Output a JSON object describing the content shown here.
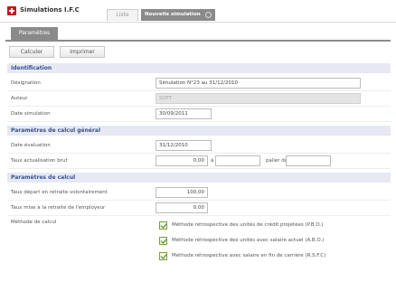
{
  "app": {
    "title": "Simulations I.F.C",
    "tabs": [
      {
        "label": "Liste"
      },
      {
        "label": "Nouvelle simulation"
      }
    ]
  },
  "subtabs": [
    {
      "label": "Paramètres"
    }
  ],
  "toolbar": {
    "calculate_label": "Calculer",
    "print_label": "Imprimer"
  },
  "identification": {
    "title": "Identification",
    "designation_label": "Désignation",
    "designation_value": "Simulation N°23 au 31/12/2010",
    "auteur_label": "Auteur",
    "auteur_value": "SOFT",
    "date_sim_label": "Date simulation",
    "date_sim_value": "30/09/2011"
  },
  "general": {
    "title": "Paramètres de calcul général",
    "date_eval_label": "Date évaluation",
    "date_eval_value": "31/12/2010",
    "taux_label": "Taux actualisation brut",
    "taux_value": "0,00",
    "a_label": "à",
    "a_value": "",
    "palier_label": "palier de",
    "palier_value": ""
  },
  "calc": {
    "title": "Paramètres de calcul",
    "depart_label": "Taux départ en retraite volontairement",
    "depart_value": "100,00",
    "mise_label": "Taux mise à la retraite de l'employeur",
    "mise_value": "0,00",
    "methode_label": "Méthode de calcul",
    "methods": [
      {
        "label": "Méthode rétrospective des unités de crédit projetées (P.B.O.)",
        "checked": true
      },
      {
        "label": "Méthode rétrospective des unités avec salaire actuel (A.B.O.)",
        "checked": true
      },
      {
        "label": "Méthode rétrospective avec salaire en fin de carrière (R.S.F.C)",
        "checked": true
      }
    ]
  }
}
